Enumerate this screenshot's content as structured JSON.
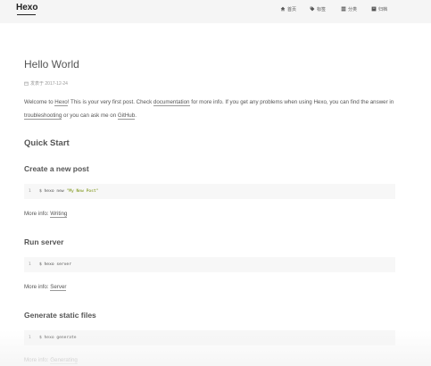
{
  "header": {
    "brand": "Hexo",
    "nav": [
      {
        "label": "首页",
        "icon": "home-icon"
      },
      {
        "label": "标签",
        "icon": "tags-icon"
      },
      {
        "label": "分类",
        "icon": "th-icon"
      },
      {
        "label": "归档",
        "icon": "archive-icon"
      }
    ]
  },
  "post": {
    "title": "Hello World",
    "meta": "发表于 2017-12-24",
    "intro": {
      "t1": "Welcome to ",
      "l1": "Hexo",
      "t2": "! This is your very first post. Check ",
      "l2": "documentation",
      "t3": " for more info. If you get any problems when using Hexo, you can find the answer in ",
      "l3": "troubleshooting",
      "t4": " or you can ask me on ",
      "l4": "GitHub",
      "t5": "."
    },
    "quick_start": "Quick Start",
    "sections": [
      {
        "heading": "Create a new post",
        "line": "1",
        "cmd": "$ hexo new ",
        "arg": "\"My New Post\"",
        "more": "More info: ",
        "link": "Writing"
      },
      {
        "heading": "Run server",
        "line": "1",
        "cmd": "$ hexo server",
        "arg": "",
        "more": "More info: ",
        "link": "Server"
      },
      {
        "heading": "Generate static files",
        "line": "1",
        "cmd": "$ hexo generate",
        "arg": "",
        "more": "More info: ",
        "link": "Generating"
      }
    ]
  }
}
